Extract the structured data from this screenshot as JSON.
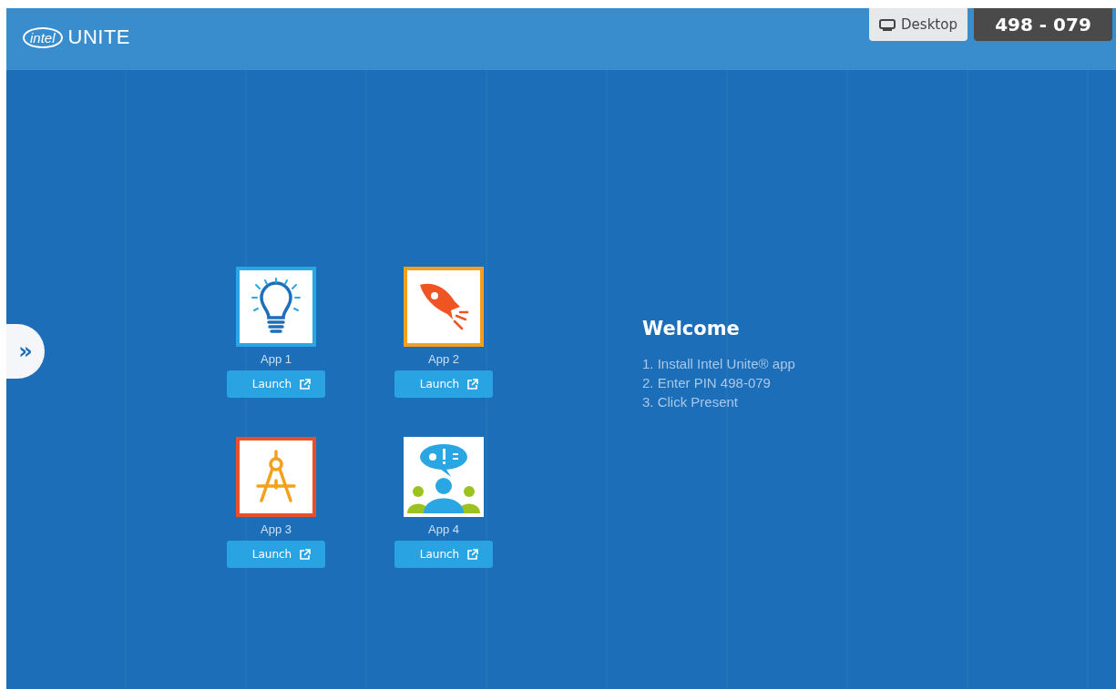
{
  "header": {
    "logo": {
      "brand": "intel",
      "product": "UNITE"
    },
    "desktop_button": {
      "label": "Desktop"
    },
    "pin": "498 - 079"
  },
  "side_tab": {
    "icon": "»"
  },
  "apps": [
    {
      "name": "App 1",
      "kind": "bulb",
      "color": "#2aa7e2",
      "button": "Launch"
    },
    {
      "name": "App 2",
      "kind": "rocket",
      "color": "#f5a01a",
      "button": "Launch"
    },
    {
      "name": "App 3",
      "kind": "compass",
      "color": "#e8502a",
      "button": "Launch"
    },
    {
      "name": "App 4",
      "kind": "people",
      "color": "#ffffff",
      "button": "Launch"
    }
  ],
  "welcome": {
    "title": "Welcome",
    "steps": [
      "1. Install Intel Unite® app",
      "2. Enter PIN 498-079",
      "3. Click Present"
    ]
  }
}
